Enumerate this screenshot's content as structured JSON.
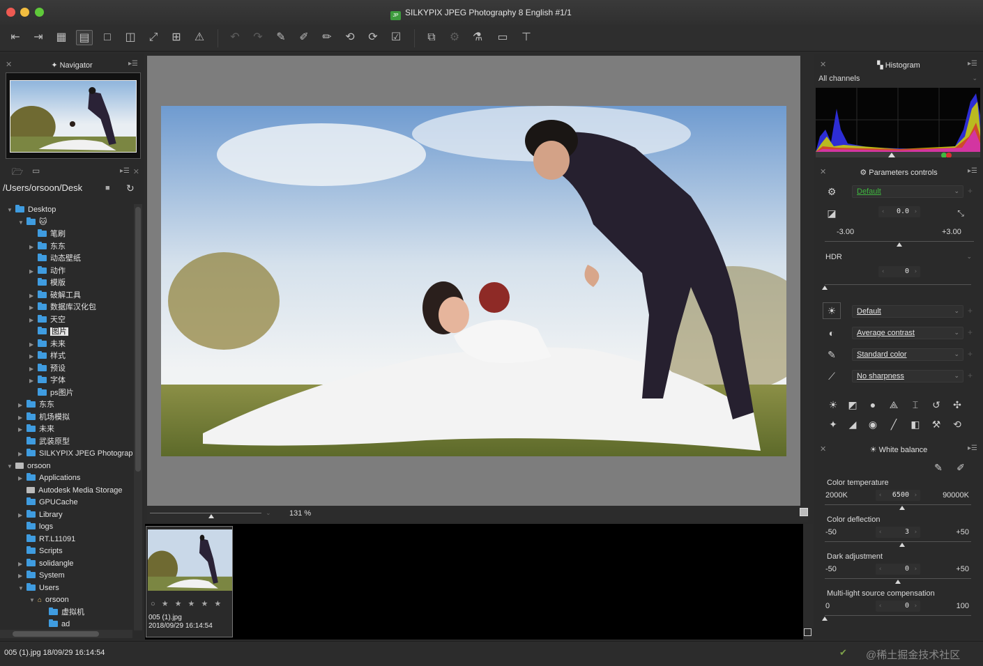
{
  "window": {
    "title": "SILKYPIX JPEG Photography 8 English   #1/1",
    "app_badge": "JP"
  },
  "toolbar": {
    "icons": [
      "undo-layout-icon",
      "redo-layout-icon",
      "grid-view-icon",
      "preview-thumbnail-view-icon",
      "single-view-icon",
      "compare-view-icon",
      "fullscreen-icon",
      "multi-view-icon",
      "warning-icon",
      "undo-icon",
      "redo-icon",
      "copy-params-icon",
      "paste-params-icon",
      "paste-selected-icon",
      "rotate-left-icon",
      "rotate-right-icon",
      "mark-icon",
      "composite-icon",
      "develop-icon",
      "bulk-develop-icon",
      "display-icon",
      "tools-icon"
    ]
  },
  "navigator": {
    "title": "Navigator"
  },
  "browser": {
    "path": "/Users/orsoon/Desk",
    "tree": [
      {
        "label": "Desktop",
        "depth": 0,
        "expanded": true,
        "kind": "folder"
      },
      {
        "label": "🐱",
        "depth": 1,
        "expanded": true,
        "kind": "folder"
      },
      {
        "label": "笔刷",
        "depth": 2,
        "kind": "folder"
      },
      {
        "label": "东东",
        "depth": 2,
        "collapsed": true,
        "kind": "folder"
      },
      {
        "label": "动态壁纸",
        "depth": 2,
        "kind": "folder"
      },
      {
        "label": "动作",
        "depth": 2,
        "collapsed": true,
        "kind": "folder"
      },
      {
        "label": "模版",
        "depth": 2,
        "kind": "folder"
      },
      {
        "label": "破解工具",
        "depth": 2,
        "collapsed": true,
        "kind": "folder"
      },
      {
        "label": "数据库汉化包",
        "depth": 2,
        "collapsed": true,
        "kind": "folder"
      },
      {
        "label": "天空",
        "depth": 2,
        "collapsed": true,
        "kind": "folder"
      },
      {
        "label": "图片",
        "depth": 2,
        "kind": "folder",
        "selected": true
      },
      {
        "label": "未来",
        "depth": 2,
        "collapsed": true,
        "kind": "folder"
      },
      {
        "label": "样式",
        "depth": 2,
        "collapsed": true,
        "kind": "folder"
      },
      {
        "label": "预设",
        "depth": 2,
        "collapsed": true,
        "kind": "folder"
      },
      {
        "label": "字体",
        "depth": 2,
        "collapsed": true,
        "kind": "folder"
      },
      {
        "label": "ps图片",
        "depth": 2,
        "kind": "folder"
      },
      {
        "label": "东东",
        "depth": 1,
        "collapsed": true,
        "kind": "folder"
      },
      {
        "label": "机场模拟",
        "depth": 1,
        "collapsed": true,
        "kind": "folder"
      },
      {
        "label": "未来",
        "depth": 1,
        "collapsed": true,
        "kind": "folder"
      },
      {
        "label": "武装原型",
        "depth": 1,
        "kind": "folder"
      },
      {
        "label": "SILKYPIX JPEG Photograp",
        "depth": 1,
        "collapsed": true,
        "kind": "folder"
      },
      {
        "label": "orsoon",
        "depth": 0,
        "expanded": true,
        "kind": "drive"
      },
      {
        "label": "Applications",
        "depth": 1,
        "collapsed": true,
        "kind": "folder"
      },
      {
        "label": "Autodesk Media Storage",
        "depth": 1,
        "kind": "drive"
      },
      {
        "label": "GPUCache",
        "depth": 1,
        "kind": "folder"
      },
      {
        "label": "Library",
        "depth": 1,
        "collapsed": true,
        "kind": "folder"
      },
      {
        "label": "logs",
        "depth": 1,
        "kind": "folder"
      },
      {
        "label": "RT.L11091",
        "depth": 1,
        "kind": "folder"
      },
      {
        "label": "Scripts",
        "depth": 1,
        "kind": "folder"
      },
      {
        "label": "solidangle",
        "depth": 1,
        "collapsed": true,
        "kind": "folder"
      },
      {
        "label": "System",
        "depth": 1,
        "collapsed": true,
        "kind": "folder"
      },
      {
        "label": "Users",
        "depth": 1,
        "expanded": true,
        "kind": "folder"
      },
      {
        "label": "orsoon",
        "depth": 2,
        "expanded": true,
        "kind": "home"
      },
      {
        "label": "虚拟机",
        "depth": 3,
        "kind": "folder"
      },
      {
        "label": "ad",
        "depth": 3,
        "kind": "folder"
      }
    ]
  },
  "viewer": {
    "zoom": "131",
    "zoom_unit": "%",
    "zoom_slider_fraction": 0.55
  },
  "filmstrip": {
    "items": [
      {
        "name": "005 (1).jpg",
        "date": "2018/09/29 16:14:54",
        "stars": "○ ★ ★ ★ ★ ★"
      }
    ]
  },
  "histogram": {
    "title": "Histogram",
    "channel": "All channels"
  },
  "params": {
    "title": "Parameters controls",
    "preset": "Default",
    "exposure_value": "0.0",
    "exposure_min": "-3.00",
    "exposure_max": "+3.00",
    "exposure_fraction": 0.5,
    "hdr_label": "HDR",
    "hdr_value": "0",
    "hdr_fraction": 0.0,
    "rows": [
      {
        "icon": "white-balance-icon",
        "value": "Default"
      },
      {
        "icon": "contrast-icon",
        "value": "Average contrast"
      },
      {
        "icon": "color-icon",
        "value": "Standard color"
      },
      {
        "icon": "sharpness-icon",
        "value": "No sharpness"
      }
    ]
  },
  "white_balance": {
    "title": "White balance",
    "color_temperature": {
      "label": "Color temperature",
      "min": "2000K",
      "max": "90000K",
      "value": "6500",
      "fraction": 0.53
    },
    "color_deflection": {
      "label": "Color deflection",
      "min": "-50",
      "max": "+50",
      "value": "3",
      "fraction": 0.53
    },
    "dark_adjustment": {
      "label": "Dark adjustment",
      "min": "-50",
      "max": "+50",
      "value": "0",
      "fraction": 0.5
    },
    "multi_light": {
      "label": "Multi-light source compensation",
      "min": "0",
      "max": "100",
      "value": "0",
      "fraction": 0.0
    }
  },
  "status": {
    "text": "005 (1).jpg 18/09/29 16:14:54",
    "watermark": "@稀土掘金技术社区"
  },
  "colors": {
    "folder": "#3f9ce0",
    "preset_green": "#3fb83f",
    "background": "#2b2b2b"
  }
}
